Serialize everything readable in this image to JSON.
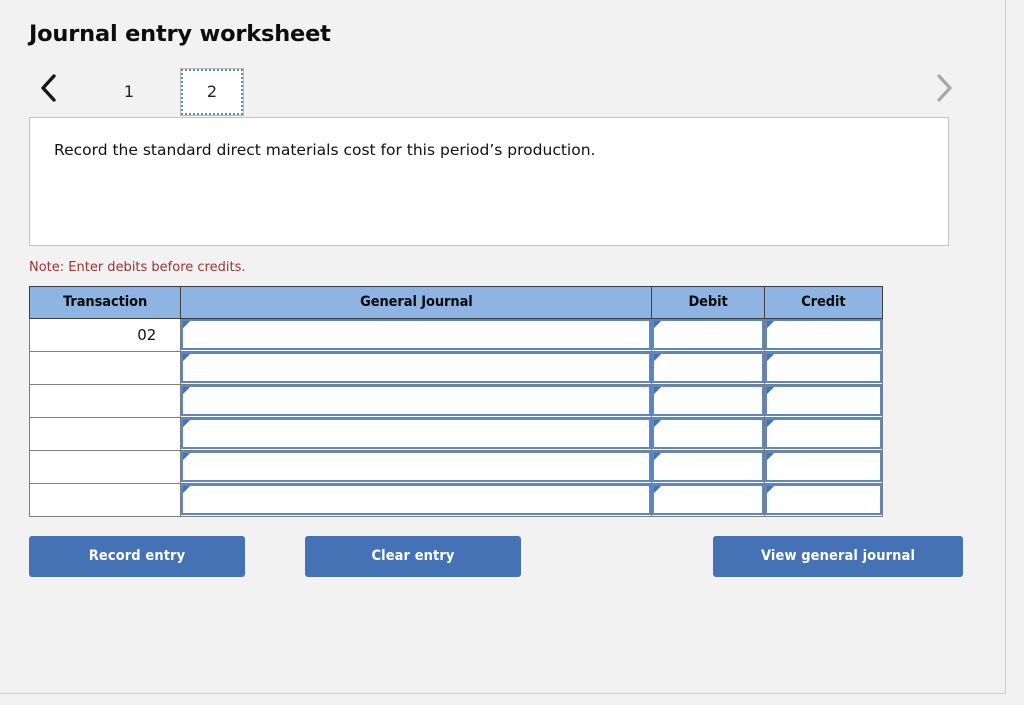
{
  "title": "Journal entry worksheet",
  "pager": {
    "prev_icon": "chevron-left-icon",
    "next_icon": "chevron-right-icon",
    "tabs": [
      {
        "label": "1",
        "selected": false
      },
      {
        "label": "2",
        "selected": true
      }
    ]
  },
  "description": "Record the standard direct materials cost for this period’s production.",
  "note": "Note: Enter debits before credits.",
  "table": {
    "columns": [
      "Transaction",
      "General Journal",
      "Debit",
      "Credit"
    ],
    "rows": [
      {
        "transaction": "02",
        "general_journal": "",
        "debit": "",
        "credit": ""
      },
      {
        "transaction": "",
        "general_journal": "",
        "debit": "",
        "credit": ""
      },
      {
        "transaction": "",
        "general_journal": "",
        "debit": "",
        "credit": ""
      },
      {
        "transaction": "",
        "general_journal": "",
        "debit": "",
        "credit": ""
      },
      {
        "transaction": "",
        "general_journal": "",
        "debit": "",
        "credit": ""
      },
      {
        "transaction": "",
        "general_journal": "",
        "debit": "",
        "credit": ""
      }
    ]
  },
  "buttons": {
    "record": "Record entry",
    "clear": "Clear entry",
    "view": "View general journal"
  },
  "colors": {
    "header_blue": "#8db4e2",
    "button_blue": "#4472b4",
    "note_red": "#a53232",
    "page_background": "#f2f2f2"
  }
}
